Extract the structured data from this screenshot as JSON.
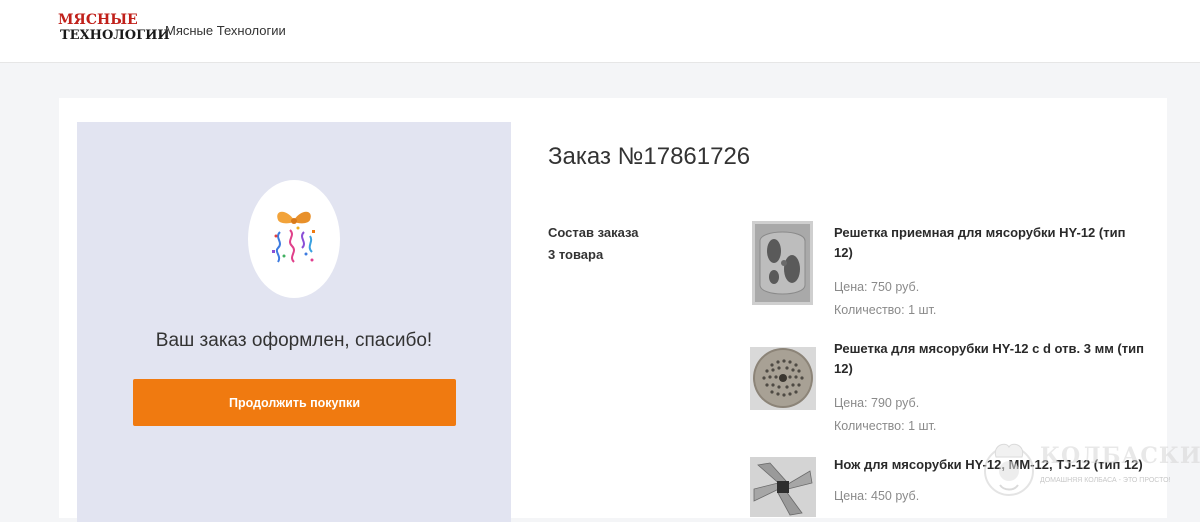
{
  "header": {
    "logo_line1": "МЯСНЫЕ",
    "logo_line2": "ТЕХНОЛОГИИ",
    "site_name": "Мясные Технологии"
  },
  "confirmation": {
    "message": "Ваш заказ оформлен, спасибо!",
    "continue_button": "Продолжить покупки"
  },
  "order": {
    "title": "Заказ №17861726",
    "composition_label": "Состав заказа",
    "items_count": "3 товара",
    "items": [
      {
        "name": "Решетка приемная для мясорубки HY-12 (тип 12)",
        "price": "Цена: 750 руб.",
        "quantity": "Количество: 1 шт.",
        "icon": "receiving-grate-image"
      },
      {
        "name": "Решетка для мясорубки HY-12 с d отв. 3 мм (тип 12)",
        "price": "Цена: 790 руб.",
        "quantity": "Количество: 1 шт.",
        "icon": "grinder-plate-image"
      },
      {
        "name": "Нож для мясорубки HY-12, MM-12, TJ-12 (тип 12)",
        "price": "Цена: 450 руб.",
        "quantity": "",
        "icon": "grinder-knife-image"
      }
    ]
  },
  "watermark": {
    "text": "КОЛБАСКИ",
    "subtext": "ДОМАШНЯЯ КОЛБАСА - ЭТО ПРОСТО!"
  }
}
